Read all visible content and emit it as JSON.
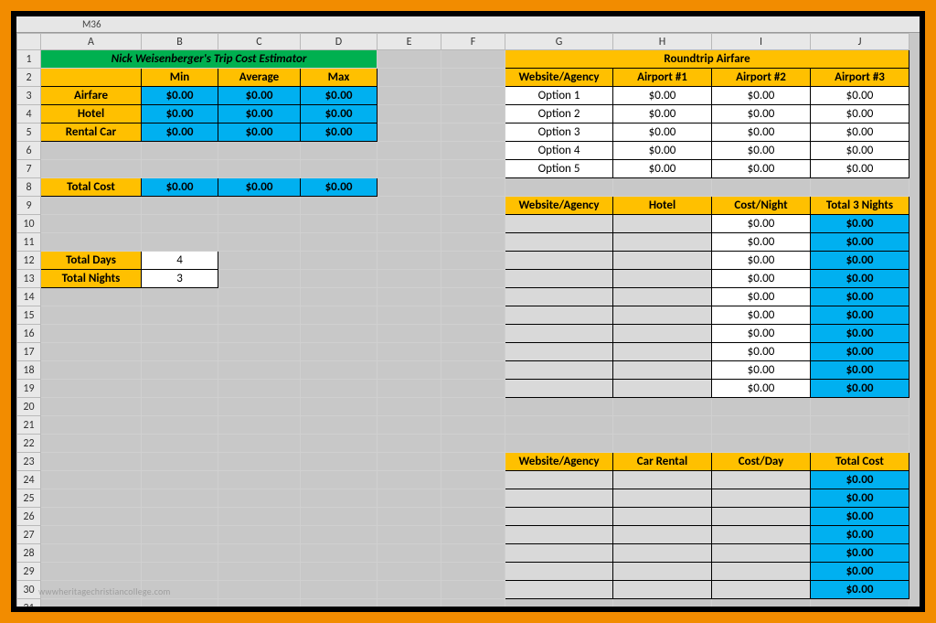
{
  "topbar": {
    "namebox": "M36"
  },
  "columns": [
    "A",
    "B",
    "C",
    "D",
    "E",
    "F",
    "G",
    "H",
    "I",
    "J"
  ],
  "rows": 31,
  "trip": {
    "title": "Nick Weisenberger's Trip Cost Estimator",
    "headers": {
      "min": "Min",
      "avg": "Average",
      "max": "Max"
    },
    "items": [
      {
        "label": "Airfare",
        "min": "$0.00",
        "avg": "$0.00",
        "max": "$0.00"
      },
      {
        "label": "Hotel",
        "min": "$0.00",
        "avg": "$0.00",
        "max": "$0.00"
      },
      {
        "label": "Rental Car",
        "min": "$0.00",
        "avg": "$0.00",
        "max": "$0.00"
      }
    ],
    "total_label": "Total Cost",
    "total": {
      "min": "$0.00",
      "avg": "$0.00",
      "max": "$0.00"
    },
    "total_days_label": "Total Days",
    "total_days": "4",
    "total_nights_label": "Total Nights",
    "total_nights": "3"
  },
  "airfare": {
    "title": "Roundtrip Airfare",
    "headers": {
      "wa": "Website/Agency",
      "a1": "Airport #1",
      "a2": "Airport #2",
      "a3": "Airport #3"
    },
    "rows": [
      {
        "wa": "Option 1",
        "a1": "$0.00",
        "a2": "$0.00",
        "a3": "$0.00"
      },
      {
        "wa": "Option 2",
        "a1": "$0.00",
        "a2": "$0.00",
        "a3": "$0.00"
      },
      {
        "wa": "Option 3",
        "a1": "$0.00",
        "a2": "$0.00",
        "a3": "$0.00"
      },
      {
        "wa": "Option 4",
        "a1": "$0.00",
        "a2": "$0.00",
        "a3": "$0.00"
      },
      {
        "wa": "Option 5",
        "a1": "$0.00",
        "a2": "$0.00",
        "a3": "$0.00"
      }
    ]
  },
  "hotel": {
    "headers": {
      "wa": "Website/Agency",
      "name": "Hotel",
      "cost": "Cost/Night",
      "total": "Total 3 Nights"
    },
    "rows": [
      {
        "wa": "",
        "name": "",
        "cost": "$0.00",
        "total": "$0.00"
      },
      {
        "wa": "",
        "name": "",
        "cost": "$0.00",
        "total": "$0.00"
      },
      {
        "wa": "",
        "name": "",
        "cost": "$0.00",
        "total": "$0.00"
      },
      {
        "wa": "",
        "name": "",
        "cost": "$0.00",
        "total": "$0.00"
      },
      {
        "wa": "",
        "name": "",
        "cost": "$0.00",
        "total": "$0.00"
      },
      {
        "wa": "",
        "name": "",
        "cost": "$0.00",
        "total": "$0.00"
      },
      {
        "wa": "",
        "name": "",
        "cost": "$0.00",
        "total": "$0.00"
      },
      {
        "wa": "",
        "name": "",
        "cost": "$0.00",
        "total": "$0.00"
      },
      {
        "wa": "",
        "name": "",
        "cost": "$0.00",
        "total": "$0.00"
      },
      {
        "wa": "",
        "name": "",
        "cost": "$0.00",
        "total": "$0.00"
      }
    ]
  },
  "car": {
    "headers": {
      "wa": "Website/Agency",
      "name": "Car Rental",
      "cost": "Cost/Day",
      "total": "Total Cost"
    },
    "rows": [
      {
        "wa": "",
        "name": "",
        "cost": "",
        "total": "$0.00"
      },
      {
        "wa": "",
        "name": "",
        "cost": "",
        "total": "$0.00"
      },
      {
        "wa": "",
        "name": "",
        "cost": "",
        "total": "$0.00"
      },
      {
        "wa": "",
        "name": "",
        "cost": "",
        "total": "$0.00"
      },
      {
        "wa": "",
        "name": "",
        "cost": "",
        "total": "$0.00"
      },
      {
        "wa": "",
        "name": "",
        "cost": "",
        "total": "$0.00"
      },
      {
        "wa": "",
        "name": "",
        "cost": "",
        "total": "$0.00"
      }
    ]
  },
  "watermark": "wwwheritagechristiancollege.com"
}
